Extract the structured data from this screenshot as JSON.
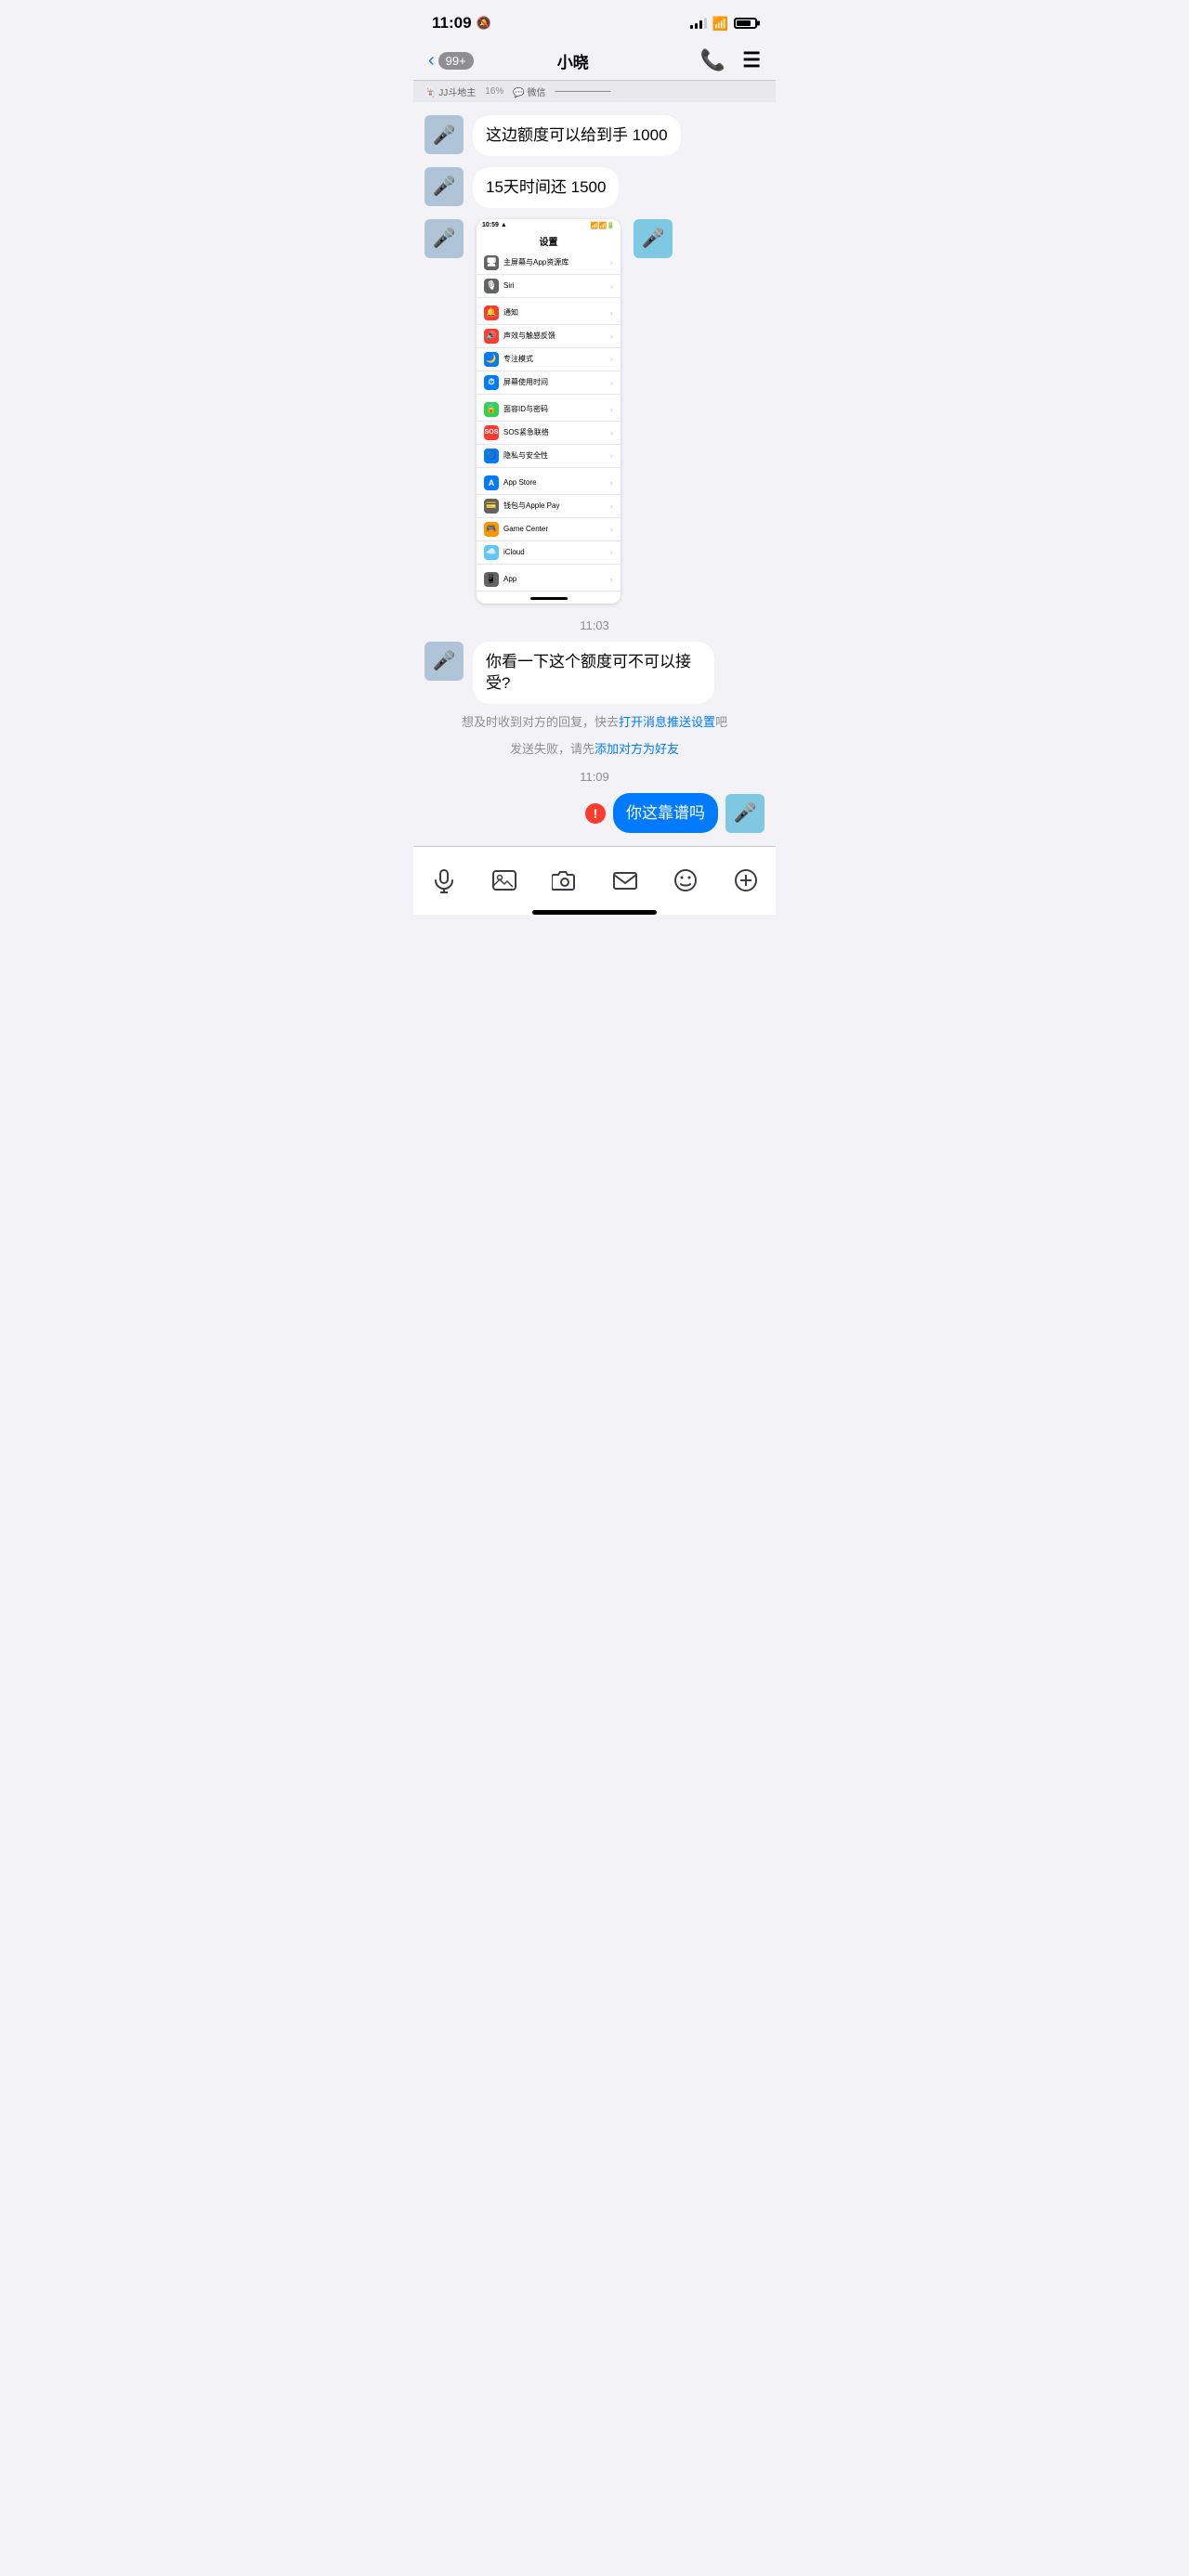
{
  "statusBar": {
    "time": "11:09",
    "muted": true,
    "batteryLevel": 80
  },
  "navBar": {
    "backLabel": "<",
    "badge": "99+",
    "title": "小晓",
    "callIcon": "📞",
    "menuIcon": "≡"
  },
  "topPreviewBar": {
    "app1": "JJ斗地主",
    "app1Percent": "16%",
    "app2": "微信"
  },
  "messages": [
    {
      "id": "msg1",
      "type": "received",
      "text": "这边额度可以给到手 1000",
      "avatar": "🎤"
    },
    {
      "id": "msg2",
      "type": "received",
      "text": "15天时间还 1500",
      "avatar": "🎤"
    },
    {
      "id": "msg3",
      "type": "received",
      "isScreenshot": true,
      "avatar": "🎤",
      "screenshot": {
        "time": "10:59",
        "title": "设置",
        "groups": [
          {
            "rows": [
              {
                "icon": "🖥️",
                "iconBg": "#636366",
                "label": "主屏幕与App资源库"
              },
              {
                "icon": "🎙️",
                "iconBg": "#636366",
                "label": "Siri"
              }
            ]
          },
          {
            "rows": [
              {
                "icon": "🔔",
                "iconBg": "#ff3b30",
                "label": "通知"
              },
              {
                "icon": "🔊",
                "iconBg": "#ff3b30",
                "label": "声效与触感反馈"
              },
              {
                "icon": "🌙",
                "iconBg": "#007aff",
                "label": "专注模式"
              },
              {
                "icon": "⏱️",
                "iconBg": "#007aff",
                "label": "屏幕使用时间"
              }
            ]
          },
          {
            "rows": [
              {
                "icon": "🔒",
                "iconBg": "#30d158",
                "label": "面容ID与密码"
              },
              {
                "icon": "🆘",
                "iconBg": "#ff3b30",
                "label": "SOS紧急联络"
              },
              {
                "icon": "🔵",
                "iconBg": "#007aff",
                "label": "隐私与安全性"
              }
            ]
          },
          {
            "rows": [
              {
                "icon": "A",
                "iconBg": "#007aff",
                "label": "App Store"
              },
              {
                "icon": "💳",
                "iconBg": "#636366",
                "label": "钱包与Apple Pay"
              },
              {
                "icon": "🎮",
                "iconBg": "#ff9500",
                "label": "Game Center"
              },
              {
                "icon": "☁️",
                "iconBg": "#5ac8fa",
                "label": "iCloud"
              }
            ]
          },
          {
            "rows": [
              {
                "icon": "📱",
                "iconBg": "#636366",
                "label": "App"
              }
            ]
          }
        ]
      }
    }
  ],
  "timestamp1": "11:03",
  "msg4": {
    "type": "received",
    "text": "你看一下这个额度可不可以接受?",
    "avatar": "🎤"
  },
  "notification": "想及时收到对方的回复，快去打开消息推送设置吧",
  "notificationLink": "打开消息推送设置",
  "sendFailed": "发送失败，请先",
  "sendFailedLink": "添加对方为好友",
  "timestamp2": "11:09",
  "msg5": {
    "type": "sent",
    "text": "你这靠谱吗",
    "hasError": true,
    "avatar": "🎤"
  },
  "inputBar": {
    "icons": [
      "mic",
      "image",
      "camera",
      "mail",
      "emoji",
      "plus"
    ]
  }
}
